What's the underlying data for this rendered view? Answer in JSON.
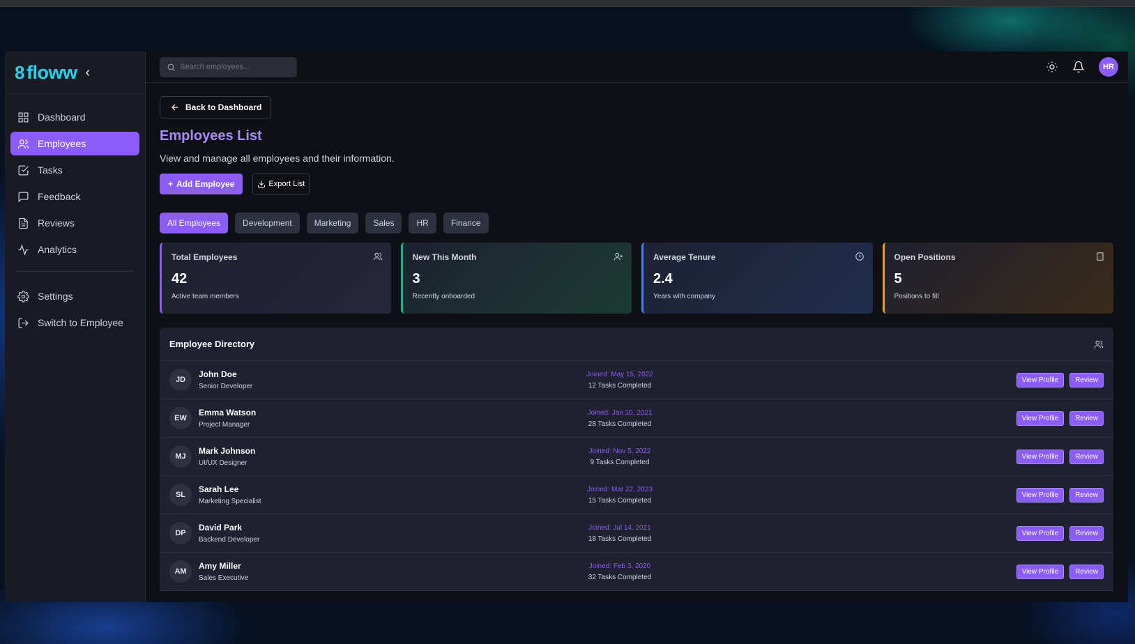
{
  "brand": {
    "name": "floww",
    "mark": "8"
  },
  "sidebar": {
    "items": [
      {
        "label": "Dashboard",
        "icon": "grid-icon"
      },
      {
        "label": "Employees",
        "icon": "users-icon",
        "active": true
      },
      {
        "label": "Tasks",
        "icon": "check-square-icon"
      },
      {
        "label": "Feedback",
        "icon": "message-square-icon"
      },
      {
        "label": "Reviews",
        "icon": "file-text-icon"
      },
      {
        "label": "Analytics",
        "icon": "activity-icon"
      }
    ],
    "bottom_items": [
      {
        "label": "Settings",
        "icon": "gear-icon"
      },
      {
        "label": "Switch to Employee",
        "icon": "log-out-icon"
      }
    ]
  },
  "header": {
    "search_placeholder": "Search employees...",
    "user_initials": "HR"
  },
  "page": {
    "back_label": "Back to Dashboard",
    "title": "Employees List",
    "subtitle": "View and manage all employees and their information.",
    "add_label": "Add Employee",
    "export_label": "Export List"
  },
  "filters": [
    "All Employees",
    "Development",
    "Marketing",
    "Sales",
    "HR",
    "Finance"
  ],
  "active_filter": "All Employees",
  "stats": [
    {
      "title": "Total Employees",
      "value": "42",
      "desc": "Active team members",
      "icon": "users-icon",
      "accent": "#8b5cf6"
    },
    {
      "title": "New This Month",
      "value": "3",
      "desc": "Recently onboarded",
      "icon": "user-plus-icon",
      "accent": "#10b981"
    },
    {
      "title": "Average Tenure",
      "value": "2.4",
      "desc": "Years with company",
      "icon": "clock-icon",
      "accent": "#3b82f6"
    },
    {
      "title": "Open Positions",
      "value": "5",
      "desc": "Positions to fill",
      "icon": "building-icon",
      "accent": "#f59e0b"
    }
  ],
  "directory": {
    "title": "Employee Directory",
    "view_label": "View Profile",
    "review_label": "Review",
    "employees": [
      {
        "initials": "JD",
        "name": "John Doe",
        "role": "Senior Developer",
        "joined": "Joined: May 15, 2022",
        "tasks": "12 Tasks Completed"
      },
      {
        "initials": "EW",
        "name": "Emma Watson",
        "role": "Project Manager",
        "joined": "Joined: Jan 10, 2021",
        "tasks": "28 Tasks Completed"
      },
      {
        "initials": "MJ",
        "name": "Mark Johnson",
        "role": "UI/UX Designer",
        "joined": "Joined: Nov 5, 2022",
        "tasks": "9 Tasks Completed"
      },
      {
        "initials": "SL",
        "name": "Sarah Lee",
        "role": "Marketing Specialist",
        "joined": "Joined: Mar 22, 2023",
        "tasks": "15 Tasks Completed"
      },
      {
        "initials": "DP",
        "name": "David Park",
        "role": "Backend Developer",
        "joined": "Joined: Jul 14, 2021",
        "tasks": "18 Tasks Completed"
      },
      {
        "initials": "AM",
        "name": "Amy Miller",
        "role": "Sales Executive",
        "joined": "Joined: Feb 3, 2020",
        "tasks": "32 Tasks Completed"
      }
    ]
  },
  "colors": {
    "accent": "#8b5cf6",
    "brand": "#22d3ee"
  }
}
